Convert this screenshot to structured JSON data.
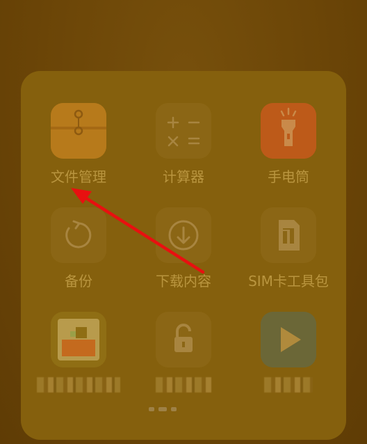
{
  "apps": [
    {
      "id": "file-manager",
      "label": "文件管理",
      "icon": "file-manager-icon"
    },
    {
      "id": "calculator",
      "label": "计算器",
      "icon": "calculator-icon"
    },
    {
      "id": "flashlight",
      "label": "手电筒",
      "icon": "flashlight-icon"
    },
    {
      "id": "backup",
      "label": "备份",
      "icon": "backup-icon"
    },
    {
      "id": "downloads",
      "label": "下载内容",
      "icon": "download-icon"
    },
    {
      "id": "sim-toolkit",
      "label": "SIM卡工具包",
      "icon": "sim-card-icon"
    },
    {
      "id": "blurred-app-1",
      "label": "",
      "icon": "sim-app-icon"
    },
    {
      "id": "blurred-app-2",
      "label": "",
      "icon": "lock-icon"
    },
    {
      "id": "blurred-app-3",
      "label": "",
      "icon": "play-icon"
    }
  ],
  "colors": {
    "overlay": "#6a4406",
    "folder": "#85600d",
    "arrow": "#e81010",
    "label": "#b9953f"
  }
}
